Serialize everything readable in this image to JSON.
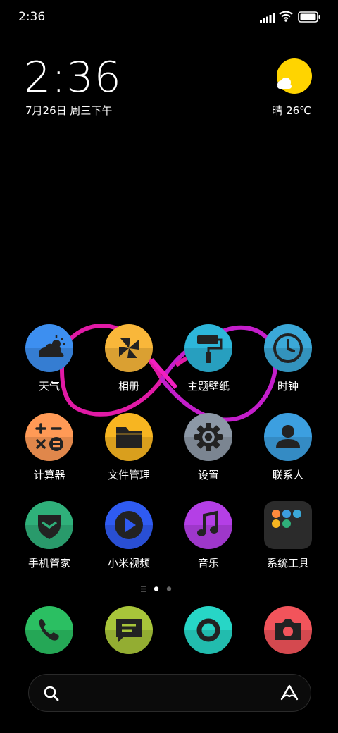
{
  "status_bar": {
    "time": "2:36"
  },
  "lock_clock": {
    "time": "2:36",
    "date": "7月26日 周三下午"
  },
  "weather": {
    "text": "晴 26℃",
    "sun_color": "#FFD400"
  },
  "apps": [
    {
      "label": "天气",
      "icon": "weather-icon",
      "color": "#3D8FF0"
    },
    {
      "label": "相册",
      "icon": "gallery-pinwheel-icon",
      "color": "#F9B73A"
    },
    {
      "label": "主题壁纸",
      "icon": "paint-roller-icon",
      "color": "#2DB6DA"
    },
    {
      "label": "时钟",
      "icon": "clock-icon",
      "color": "#3BA8D8"
    },
    {
      "label": "计算器",
      "icon": "calculator-icon",
      "color": "#FF9A56"
    },
    {
      "label": "文件管理",
      "icon": "folder-icon",
      "color": "#F7B521"
    },
    {
      "label": "设置",
      "icon": "gear-icon",
      "color": "#8C98A6"
    },
    {
      "label": "联系人",
      "icon": "contact-icon",
      "color": "#3C9FE0"
    },
    {
      "label": "手机管家",
      "icon": "shield-icon",
      "color": "#2FB07A"
    },
    {
      "label": "小米视频",
      "icon": "play-icon",
      "color": "#2F5BF2"
    },
    {
      "label": "音乐",
      "icon": "music-note-icon",
      "color": "#B43FE6"
    },
    {
      "label": "系统工具",
      "icon": "folder-group-icon",
      "color": "#2B2B2B"
    }
  ],
  "dock": [
    {
      "icon": "phone-icon",
      "color": "#2BBF62"
    },
    {
      "icon": "message-icon",
      "color": "#A8C53A"
    },
    {
      "icon": "browser-icon",
      "color": "#27D6C6"
    },
    {
      "icon": "camera-icon",
      "color": "#F2545B"
    }
  ],
  "search_bar": {
    "left_icon": "search-icon",
    "right_icon": "assistant-icon"
  }
}
